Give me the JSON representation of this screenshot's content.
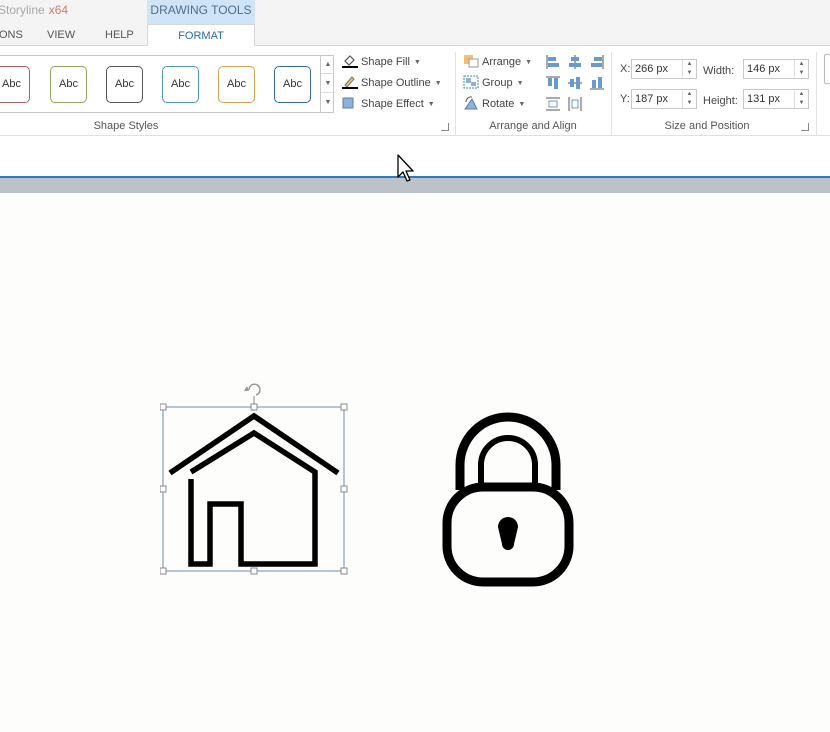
{
  "app": {
    "title": "Storyline",
    "arch": "x64"
  },
  "context_tab_group": "DRAWING TOOLS",
  "tabs": [
    {
      "label": "ONS",
      "active": false
    },
    {
      "label": "VIEW",
      "active": false
    },
    {
      "label": "HELP",
      "active": false
    },
    {
      "label": "FORMAT",
      "active": true
    }
  ],
  "shape_styles": {
    "label": "Shape Styles",
    "gallery": [
      {
        "text": "Abc",
        "border": "#b06060"
      },
      {
        "text": "Abc",
        "border": "#8fa85a"
      },
      {
        "text": "Abc",
        "border": "#555555"
      },
      {
        "text": "Abc",
        "border": "#4a9ab8"
      },
      {
        "text": "Abc",
        "border": "#d9a050"
      },
      {
        "text": "Abc",
        "border": "#2f6f9a"
      }
    ],
    "commands": {
      "fill": "Shape Fill",
      "outline": "Shape Outline",
      "effect": "Shape Effect"
    }
  },
  "arrange": {
    "label": "Arrange and Align",
    "commands": {
      "arrange": "Arrange",
      "group": "Group",
      "rotate": "Rotate"
    }
  },
  "size_position": {
    "label": "Size and Position",
    "x_label": "X:",
    "x": "266 px",
    "y_label": "Y:",
    "y": "187 px",
    "width_label": "Width:",
    "width": "146 px",
    "height_label": "Height:",
    "height": "131 px"
  },
  "canvas_objects": [
    {
      "icon": "house-icon",
      "selected": true
    },
    {
      "icon": "lock-icon",
      "selected": false
    }
  ],
  "colors": {
    "accent": "#2b79c2",
    "context_tab": "#cfe4f6",
    "selection": "#6b8fb0"
  }
}
